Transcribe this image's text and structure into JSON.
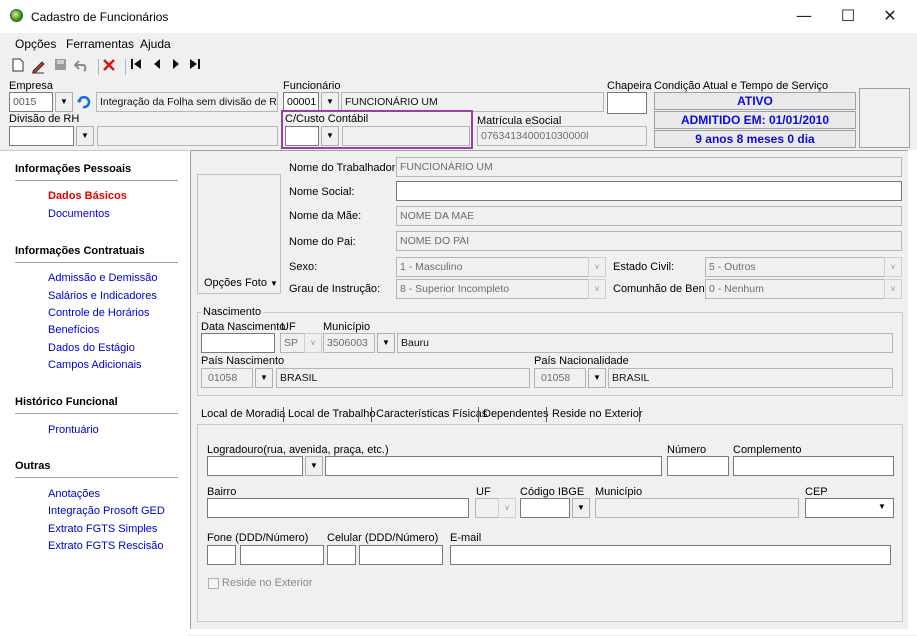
{
  "window": {
    "title": "Cadastro de Funcionários",
    "controls": {
      "minimize": "—",
      "maximize": "☐",
      "close": "✕"
    }
  },
  "menu": {
    "items": [
      "Opções",
      "Ferramentas",
      "Ajuda"
    ]
  },
  "toolbar": {
    "icons": [
      "new-document-icon",
      "edit-icon",
      "save-icon",
      "undo-icon",
      "delete-icon",
      "first-record-icon",
      "previous-record-icon",
      "next-record-icon",
      "last-record-icon"
    ]
  },
  "header": {
    "empresa": {
      "label": "Empresa",
      "code": "0015",
      "name": "Integração da Folha  sem divisão de RH"
    },
    "funcionario": {
      "label": "Funcionário",
      "code": "00001",
      "name": "FUNCIONÁRIO UM"
    },
    "chapeira": {
      "label": "Chapeira",
      "value": ""
    },
    "condicao": {
      "label": "Condição Atual e Tempo de Serviço",
      "status": "ATIVO",
      "admitido": "ADMITIDO EM: 01/01/2010",
      "tempo": "9 anos 8 meses 0 dia"
    },
    "divisao": {
      "label": "Divisão de RH",
      "code": "",
      "name": ""
    },
    "custo": {
      "label": "C/Custo Contábil",
      "code": "",
      "name": ""
    },
    "esocial": {
      "label": "Matrícula eSocial",
      "value": "076341340001030000l"
    }
  },
  "sidebar": {
    "sections": [
      {
        "title": "Informações Pessoais",
        "items": [
          "Dados Básicos",
          "Documentos"
        ]
      },
      {
        "title": "Informações Contratuais",
        "items": [
          "Admissão e Demissão",
          "Salários e Indicadores",
          "Controle de Horários",
          "Benefícios",
          "Dados do Estágio",
          "Campos Adicionais"
        ]
      },
      {
        "title": "Histórico Funcional",
        "items": [
          "Prontuário"
        ]
      },
      {
        "title": "Outras",
        "items": [
          "Anotações",
          "Integração Prosoft GED",
          "Extrato FGTS Simples",
          "Extrato FGTS Rescisão"
        ]
      }
    ],
    "active": "Dados Básicos"
  },
  "basic": {
    "photo_button": "Opções Foto",
    "nome_trabalhador": {
      "label": "Nome do Trabalhador:",
      "value": "FUNCIONÁRIO UM"
    },
    "nome_social": {
      "label": "Nome Social:",
      "value": ""
    },
    "nome_mae": {
      "label": "Nome da Mãe:",
      "value": "NOME DA MAE"
    },
    "nome_pai": {
      "label": "Nome do Pai:",
      "value": "NOME DO PAI"
    },
    "sexo": {
      "label": "Sexo:",
      "value": "1 - Masculino"
    },
    "estado_civil": {
      "label": "Estado Civil:",
      "value": "5 - Outros"
    },
    "grau_instrucao": {
      "label": "Grau de Instrução:",
      "value": "8 - Superior Incompleto"
    },
    "comunhao": {
      "label": "Comunhão de Bens:",
      "value": "0 - Nenhum"
    }
  },
  "nascimento": {
    "group_label": "Nascimento",
    "data_label": "Data Nascimento",
    "data_value": "",
    "uf_label": "UF",
    "uf_value": "SP",
    "municipio_label": "Município",
    "municipio_code": "3506003",
    "municipio_name": "Bauru",
    "pais_nasc_label": "País Nascimento",
    "pais_nasc_code": "01058",
    "pais_nasc_name": "BRASIL",
    "pais_nac_label": "País Nacionalidade",
    "pais_nac_code": "01058",
    "pais_nac_name": "BRASIL"
  },
  "tabs": {
    "items": [
      "Local de Moradia",
      "Local de Trabalho",
      "Características Físicas",
      "Dependentes",
      "Reside no Exterior"
    ],
    "active": "Local de Moradia"
  },
  "moradia": {
    "logradouro_label": "Logradouro(rua, avenida, praça, etc.)",
    "numero_label": "Número",
    "complemento_label": "Complemento",
    "bairro_label": "Bairro",
    "uf_label": "UF",
    "ibge_label": "Código IBGE",
    "municipio_label": "Município",
    "cep_label": "CEP",
    "fone_label": "Fone (DDD/Número)",
    "celular_label": "Celular (DDD/Número)",
    "email_label": "E-mail",
    "reside_exterior_label": "Reside no Exterior"
  }
}
